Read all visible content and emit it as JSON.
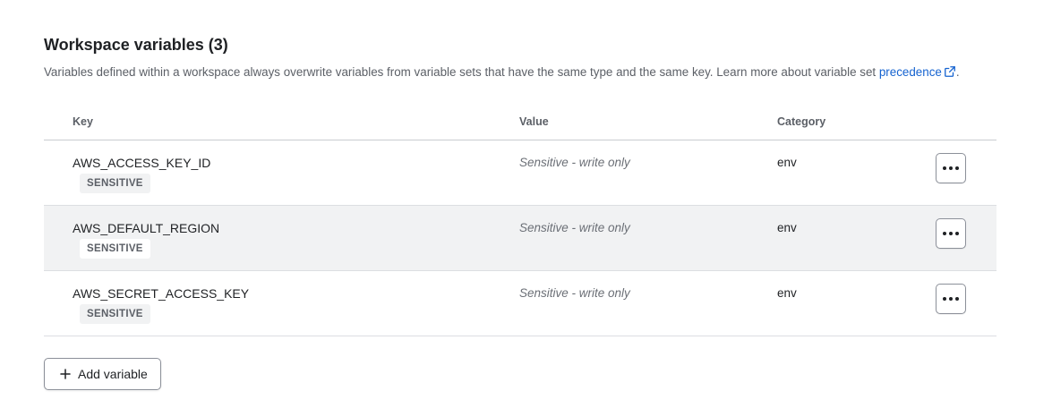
{
  "section": {
    "title": "Workspace variables (3)",
    "description": "Variables defined within a workspace always overwrite variables from variable sets that have the same type and the same key. Learn more about variable set ",
    "link_text": "precedence",
    "trailing": "."
  },
  "table": {
    "headers": {
      "key": "Key",
      "value": "Value",
      "category": "Category"
    },
    "rows": [
      {
        "key": "AWS_ACCESS_KEY_ID",
        "badge": "SENSITIVE",
        "value": "Sensitive - write only",
        "category": "env"
      },
      {
        "key": "AWS_DEFAULT_REGION",
        "badge": "SENSITIVE",
        "value": "Sensitive - write only",
        "category": "env"
      },
      {
        "key": "AWS_SECRET_ACCESS_KEY",
        "badge": "SENSITIVE",
        "value": "Sensitive - write only",
        "category": "env"
      }
    ],
    "row_action_icon": "more-horizontal-icon"
  },
  "actions": {
    "add_label": "Add variable",
    "add_icon": "plus-icon"
  },
  "colors": {
    "link": "#1563d0",
    "hover_row": "#f1f2f3",
    "badge_bg": "#f1f2f3"
  }
}
